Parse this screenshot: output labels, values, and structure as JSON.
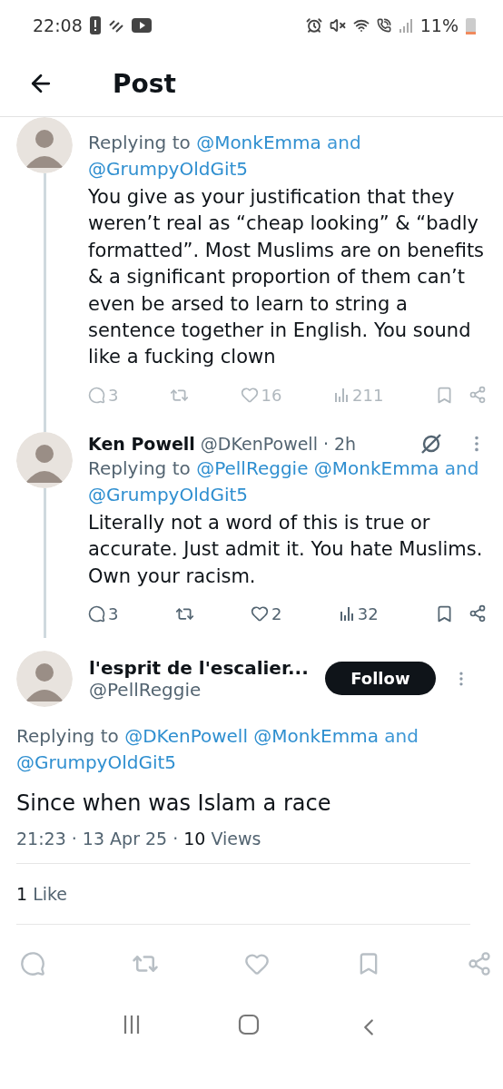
{
  "status_bar": {
    "time": "22:08",
    "battery": "11%"
  },
  "header": {
    "title": "Post"
  },
  "replies": [
    {
      "replying_prefix": "Replying to",
      "replying_parts": [
        {
          "kind": "mention",
          "text": "@MonkEmma"
        },
        {
          "kind": "word",
          "text": "and"
        },
        {
          "kind": "mention",
          "text": "@GrumpyOldGit5"
        }
      ],
      "body": "You give as your justification that they weren’t real as “cheap looking” & “badly formatted”. Most Muslims are on benefits & a significant proportion of them can’t even be arsed to learn to string a sentence together in English. You sound like a fucking clown",
      "dimmed": true,
      "actions": {
        "replies": "3",
        "likes": "16",
        "views": "211"
      }
    },
    {
      "author": "Ken Powell",
      "handle": "@DKenPowell",
      "time": "· 2h",
      "replying_prefix": "Replying to",
      "replying_parts": [
        {
          "kind": "mention",
          "text": "@PellReggie"
        },
        {
          "kind": "mention",
          "text": "@MonkEmma"
        },
        {
          "kind": "word",
          "text": "and"
        },
        {
          "kind": "mention",
          "text": "@GrumpyOldGit5"
        }
      ],
      "body": "Literally not a word of this is true or accurate. Just admit it. You hate Muslims. Own your racism.",
      "dimmed": false,
      "actions": {
        "replies": "3",
        "likes": "2",
        "views": "32"
      }
    }
  ],
  "main_post": {
    "author": "l'esprit de l'escalier...",
    "handle": "@PellReggie",
    "follow_label": "Follow",
    "replying_prefix": "Replying to",
    "replying_parts": [
      {
        "kind": "mention",
        "text": "@DKenPowell"
      },
      {
        "kind": "mention",
        "text": "@MonkEmma"
      },
      {
        "kind": "word",
        "text": "and"
      },
      {
        "kind": "mention",
        "text": "@GrumpyOldGit5"
      }
    ],
    "body": "Since when was Islam a race",
    "timestamp": "21:23 · 13 Apr 25 ·",
    "views_count": "10",
    "views_label": "Views",
    "likes_count": "1",
    "likes_label": "Like"
  }
}
